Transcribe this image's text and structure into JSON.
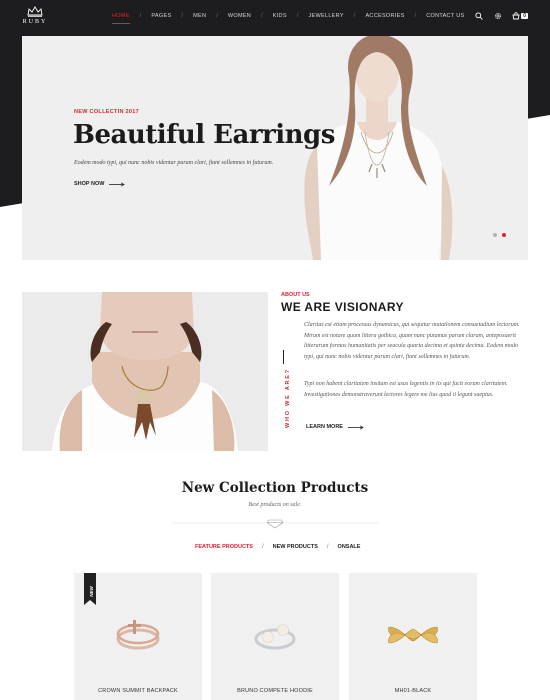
{
  "brand": {
    "name": "RUBY"
  },
  "nav": {
    "items": [
      {
        "label": "HOME",
        "active": true
      },
      {
        "label": "PAGES"
      },
      {
        "label": "MEN"
      },
      {
        "label": "WOMEN"
      },
      {
        "label": "KIDS"
      },
      {
        "label": "JEWELLERY"
      },
      {
        "label": "ACCESORIES"
      },
      {
        "label": "CONTACT US"
      }
    ],
    "separator": "/",
    "cart_count": "0",
    "icons": [
      "search-icon",
      "gear-icon",
      "cart-icon"
    ]
  },
  "hero": {
    "subtitle": "NEW COLLECTIN 2017",
    "title": "Beautiful Earrings",
    "description": "Eodem modo typi, qui nunc nobis videntur parum clari, fiant sollemnes in futurum.",
    "cta": "SHOP NOW",
    "slides": 2,
    "active_slide": 2
  },
  "about": {
    "label": "ABOUT US",
    "title": "WE ARE VISIONARY",
    "vertical_label": "WHO WE ARE?",
    "paragraph1": "Claritas est etiam processus dynamicus, qui sequitur mutationem consuetudium lectorum. Mirum est notare quam littera gothica, quam nunc putamus parum claram, anteposuerit litterarum formas humanitatis per seacula quarta decima et quinta decima. Eodem modo typi, qui nunc nobis videntur parum clari, fiant sollemnes in futurum.",
    "paragraph2": "Typi non habent claritatem insitam est usus legentis in iis qui facit eorum claritatem. Investigationes demonstraverunt lectores legere me lius quod ii legunt saepius.",
    "cta": "LEARN MORE"
  },
  "products": {
    "title": "New Collection Products",
    "subtitle": "Best products on sale.",
    "tabs": [
      {
        "label": "FEATURE PRODUCTS",
        "active": true
      },
      {
        "label": "NEW PRODUCTS"
      },
      {
        "label": "ONSALE"
      }
    ],
    "items": [
      {
        "name": "CROWN SUMMIT BACKPACK",
        "badge": "NEW"
      },
      {
        "name": "BRUNO COMPETE HOODIE"
      },
      {
        "name": "MH01-BLACK"
      }
    ]
  },
  "colors": {
    "accent": "#e0232c",
    "dark": "#1d1d1f",
    "panel": "#efeff0"
  }
}
